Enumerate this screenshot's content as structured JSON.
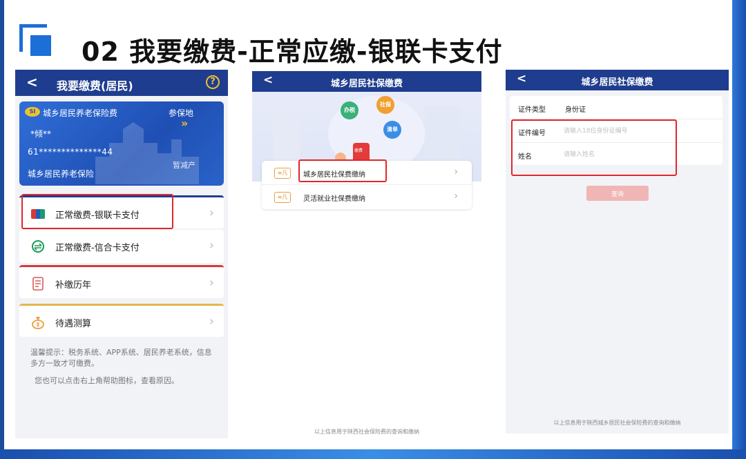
{
  "slide": {
    "title": "02 我要缴费-正常应缴-银联卡支付"
  },
  "screen1": {
    "nav": {
      "back": "<",
      "title": "我要缴费(居民)",
      "help": "?"
    },
    "card": {
      "logo": "SI",
      "title": "城乡居民养老保险费",
      "region_label": "参保地",
      "region_chevron": "»",
      "name_masked": "*倾**",
      "id_masked": "61**************44",
      "insurance_type": "城乡居民养老保险",
      "status": "暂减产"
    },
    "menu": [
      {
        "label": "正常缴费-银联卡支付",
        "arrow": "›"
      },
      {
        "label": "正常缴费-信合卡支付",
        "arrow": "›"
      },
      {
        "label": "补缴历年",
        "arrow": "›"
      },
      {
        "label": "待遇测算",
        "arrow": "›"
      }
    ],
    "tip1": "温馨提示：税务系统、APP系统、居民养老系统，信息多方一致才可缴费。",
    "tip2": "您也可以点击右上角帮助图标，查看原因。"
  },
  "screen2": {
    "nav": {
      "back": "<",
      "title": "城乡居民社保缴费"
    },
    "banner": {
      "bubbles": [
        "办税",
        "社保",
        "清单"
      ],
      "phone_label": "缴费"
    },
    "items": [
      {
        "icon": "≡凡",
        "label": "城乡居民社保费缴纳",
        "arrow": "›"
      },
      {
        "icon": "≡凡",
        "label": "灵活就业社保费缴纳",
        "arrow": "›"
      }
    ],
    "footer": "以上信息用于陕西社会保险费的查询和缴纳"
  },
  "screen3": {
    "nav": {
      "back": "<",
      "title": "城乡居民社保缴费"
    },
    "form": {
      "id_type_label": "证件类型",
      "id_type_value": "身份证",
      "id_no_label": "证件编号",
      "id_no_placeholder": "请输入18位身份证编号",
      "name_label": "姓名",
      "name_placeholder": "请输入姓名"
    },
    "query_label": "查询",
    "footer": "以上信息用于陕西城乡居民社会保险费的查询和缴纳"
  },
  "colors": {
    "nav_blue": "#1f3d8e",
    "highlight_red": "#e0262a",
    "accent_blue": "#1b6fd6",
    "gold": "#f0c030"
  }
}
